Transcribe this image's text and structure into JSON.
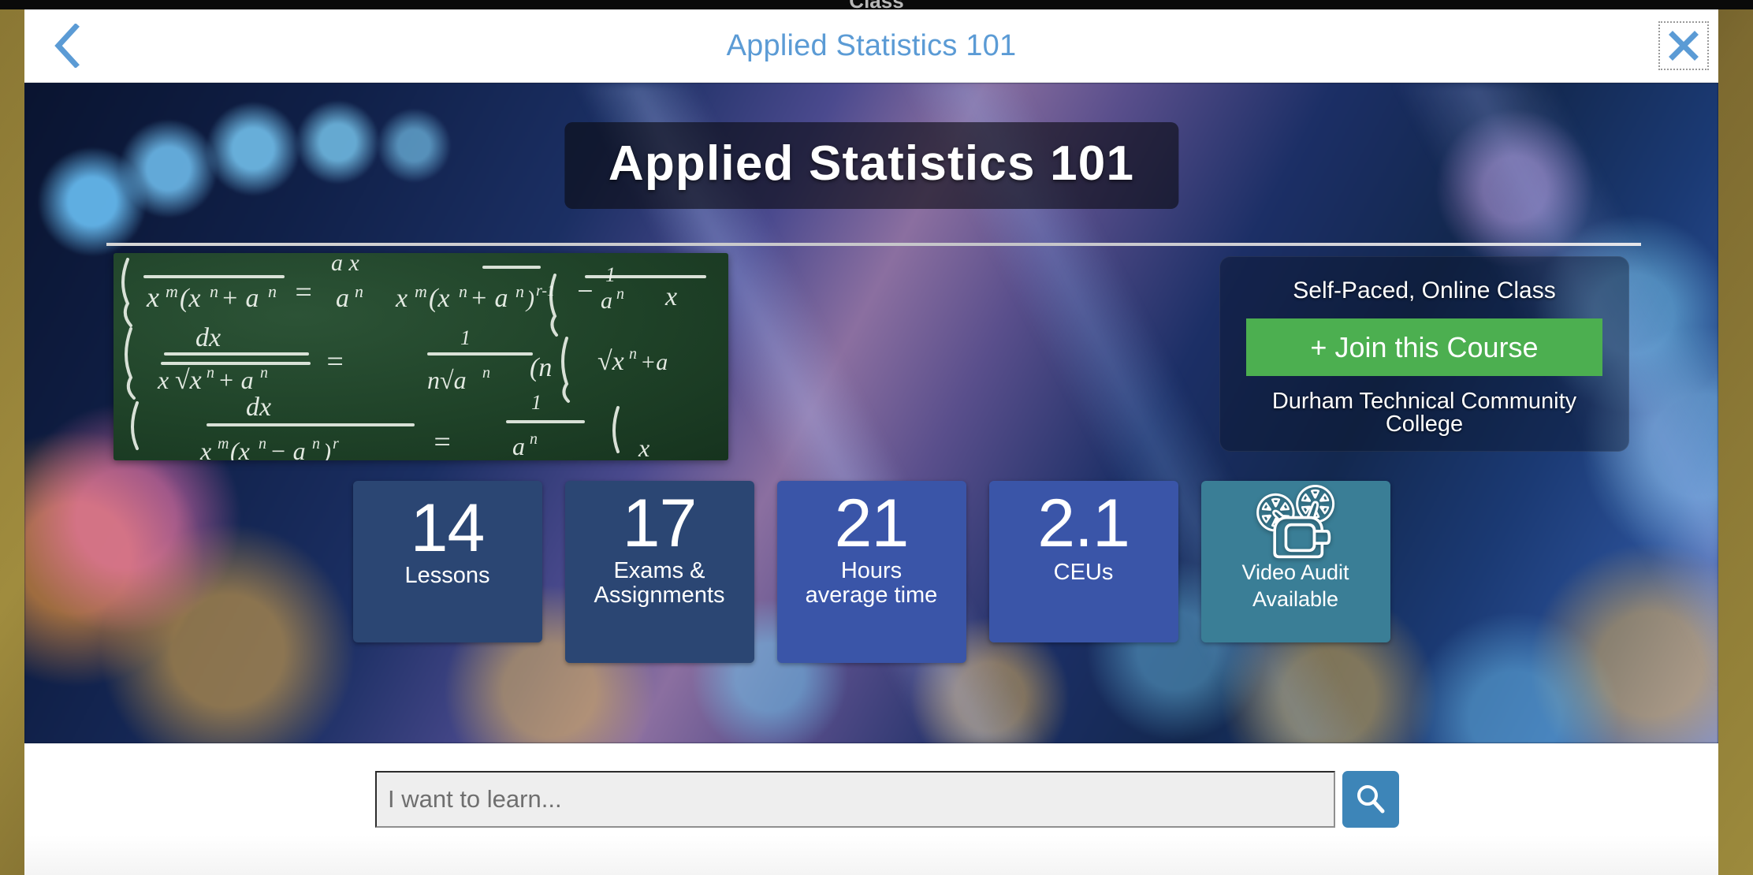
{
  "window": {
    "cut_off_text": "Class"
  },
  "header": {
    "title": "Applied Statistics 101",
    "back_icon": "chevron-left-icon",
    "close_icon": "close-x-icon",
    "accent_color": "#5b9bd5"
  },
  "hero": {
    "title": "Applied Statistics 101",
    "chalkboard_alt": "green chalkboard with calculus integral formulas",
    "info_panel": {
      "mode": "Self-Paced, Online Class",
      "join_label": "+ Join this Course",
      "join_color": "#4caf50",
      "institution": "Durham Technical Community College"
    },
    "stats": [
      {
        "value": "14",
        "label": "Lessons",
        "color": "#2b4673",
        "icon": ""
      },
      {
        "value": "17",
        "label": "Exams &\nAssignments",
        "label_line1": "Exams &",
        "label_line2": "Assignments",
        "color": "#2b4673",
        "icon": ""
      },
      {
        "value": "21",
        "label_line1": "Hours",
        "label_line2": "average time",
        "color": "#3a55a8",
        "icon": ""
      },
      {
        "value": "2.1",
        "label": "CEUs",
        "color": "#3a55a8",
        "icon": ""
      },
      {
        "value": "",
        "label_line1": "Video Audit",
        "label_line2": "Available",
        "color": "#3a7e96",
        "icon": "movie-projector-icon",
        "glyph": "📽"
      }
    ]
  },
  "search": {
    "placeholder": "I want to learn...",
    "value": "",
    "button_icon": "search-icon",
    "button_color": "#3d85b8"
  }
}
